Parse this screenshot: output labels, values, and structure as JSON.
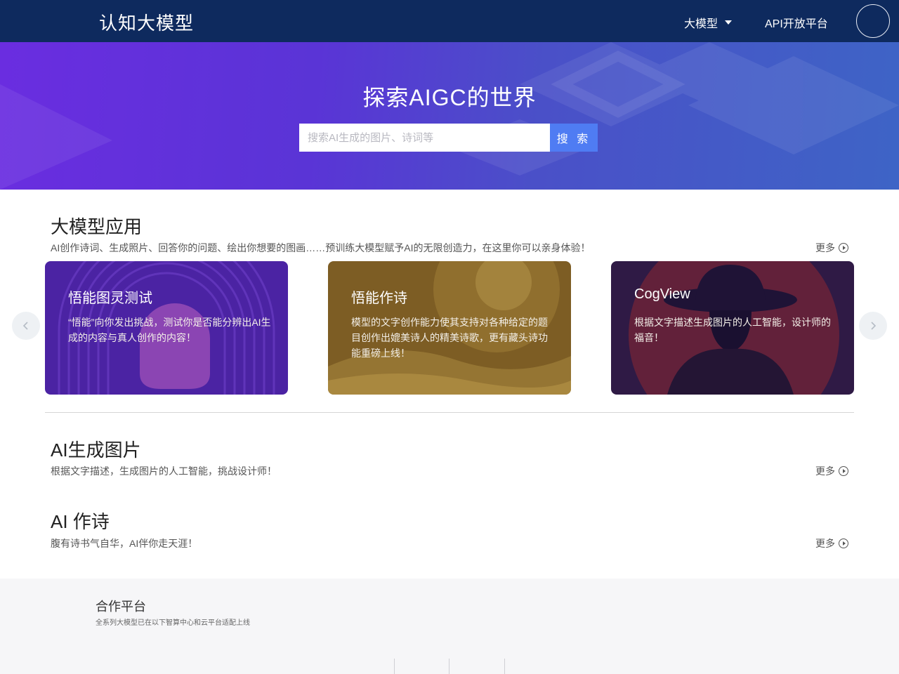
{
  "header": {
    "brand": "认知大模型",
    "nav_models": "大模型",
    "nav_api": "API开放平台"
  },
  "hero": {
    "title": "探索AIGC的世界",
    "search_placeholder": "搜索AI生成的图片、诗词等",
    "search_button": "搜 索"
  },
  "apps": {
    "title": "大模型应用",
    "desc": "AI创作诗词、生成照片、回答你的问题、绘出你想要的图画……预训练大模型赋予AI的无限创造力，在这里你可以亲身体验！",
    "more": "更多",
    "cards": [
      {
        "title": "悟能图灵测试",
        "desc": "“悟能”向你发出挑战，测试你是否能分辨出AI生成的内容与真人创作的内容！",
        "color": "#4b23a3"
      },
      {
        "title": "悟能作诗",
        "desc": "模型的文字创作能力使其支持对各种给定的题目创作出媲美诗人的精美诗歌，更有藏头诗功能重磅上线！",
        "color": "#8a6a2a"
      },
      {
        "title": "CogView",
        "desc": "根据文字描述生成图片的人工智能，设计师的福音！",
        "color": "#3a1f4e"
      }
    ]
  },
  "image_section": {
    "title": "AI生成图片",
    "desc": "根据文字描述，生成图片的人工智能，挑战设计师！",
    "more": "更多"
  },
  "poem_section": {
    "title": "AI 作诗",
    "desc": "腹有诗书气自华，AI伴你走天涯！",
    "more": "更多"
  },
  "partners": {
    "title": "合作平台",
    "desc": "全系列大模型已在以下智算中心和云平台适配上线"
  },
  "colors": {
    "header_bg": "#0e2a5e",
    "search_button": "#4f7cf3",
    "hero_gradient_start": "#6a2de0",
    "hero_gradient_end": "#3e64c6"
  }
}
